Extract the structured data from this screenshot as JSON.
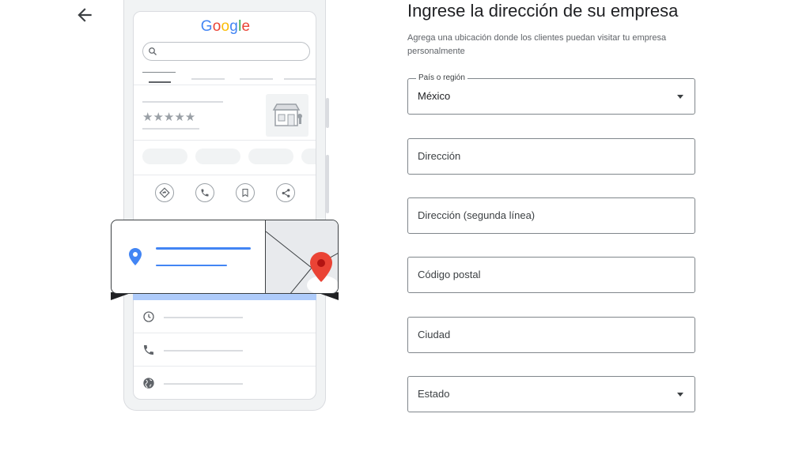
{
  "nav": {
    "back_icon": "arrow-left-icon"
  },
  "illustration": {
    "logo_text": "Google",
    "logo_letters": [
      {
        "ch": "G",
        "color": "#4285f4"
      },
      {
        "ch": "o",
        "color": "#ea4335"
      },
      {
        "ch": "o",
        "color": "#fbbc05"
      },
      {
        "ch": "g",
        "color": "#4285f4"
      },
      {
        "ch": "l",
        "color": "#34a853"
      },
      {
        "ch": "e",
        "color": "#ea4335"
      }
    ],
    "rating_stars": "★★★★★",
    "action_icons": [
      "directions-icon",
      "phone-icon",
      "bookmark-icon",
      "share-icon"
    ],
    "info_icons": [
      "clock-icon",
      "phone-icon",
      "globe-icon"
    ],
    "location_pin_color": "#4285f4",
    "map_pin_color": "#ea4335"
  },
  "form": {
    "title": "Ingrese la dirección de su empresa",
    "subtitle": "Agrega una ubicación donde los clientes puedan visitar tu empresa personalmente",
    "country": {
      "label": "País o región",
      "value": "México"
    },
    "address": {
      "placeholder": "Dirección"
    },
    "address2": {
      "placeholder": "Dirección (segunda línea)"
    },
    "postal_code": {
      "placeholder": "Código postal"
    },
    "city": {
      "placeholder": "Ciudad"
    },
    "state": {
      "placeholder": "Estado"
    }
  },
  "colors": {
    "text": "#202124",
    "border": "#80868b",
    "accent": "#4285f4"
  }
}
